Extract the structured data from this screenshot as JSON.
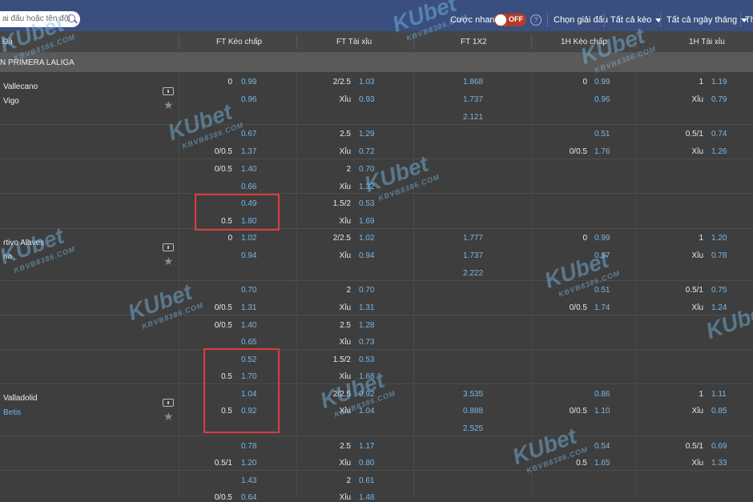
{
  "topbar": {
    "search_placeholder": "ai đấu hoặc tên đội",
    "quick_bet_label": "Cược nhanh",
    "toggle_state": "OFF",
    "help_icon": "?",
    "league_select": "Chọn giải đấu",
    "all_markets": "Tất cả kèo",
    "all_dates": "Tất cả ngày tháng",
    "cut_item": "Th"
  },
  "columns": {
    "match": "Đá",
    "ft_handicap": "FT Kèo chấp",
    "ft_ou": "FT Tài xỉu",
    "ft_1x2": "FT 1X2",
    "h1_handicap": "1H Kèo chấp",
    "h1_ou": "1H Tài xỉu"
  },
  "league": "N PRIMERA LALIGA",
  "matches": [
    {
      "home": "Vallecano",
      "away": "Vigo",
      "home_blue": false,
      "away_blue": false
    },
    {
      "home": "rtivo Alaves",
      "away": "na",
      "home_blue": false,
      "away_blue": false
    },
    {
      "home": "Valladolid",
      "away": "Betis",
      "home_blue": false,
      "away_blue": true
    }
  ],
  "icons": {
    "stats": "stats-icon",
    "star": "★"
  },
  "rows": [
    {
      "hh": "0",
      "ho": "0.99",
      "th": "2/2.5",
      "to": "1.03",
      "x": "1.868",
      "h1h": "0",
      "h1o": "0.99",
      "t1h": "1",
      "t1o": "1.19"
    },
    {
      "hh": "",
      "ho": "0.96",
      "th": "Xỉu",
      "to": "0.93",
      "x": "1.737",
      "h1h": "",
      "h1o": "0.96",
      "t1h": "Xỉu",
      "t1o": "0.79"
    },
    {
      "hh": "",
      "ho": "",
      "th": "",
      "to": "",
      "x": "2.121",
      "h1h": "",
      "h1o": "",
      "t1h": "",
      "t1o": ""
    },
    {
      "hh": "",
      "ho": "0.67",
      "th": "2.5",
      "to": "1.29",
      "x": "",
      "h1h": "",
      "h1o": "0.51",
      "t1h": "0.5/1",
      "t1o": "0.74"
    },
    {
      "hh": "0/0.5",
      "ho": "1.37",
      "th": "Xỉu",
      "to": "0.72",
      "x": "",
      "h1h": "0/0.5",
      "h1o": "1.76",
      "t1h": "Xỉu",
      "t1o": "1.26"
    },
    {
      "hh": "0/0.5",
      "ho": "1.40",
      "th": "2",
      "to": "0.70",
      "x": "",
      "h1h": "",
      "h1o": "",
      "t1h": "",
      "t1o": ""
    },
    {
      "hh": "",
      "ho": "0.66",
      "th": "Xỉu",
      "to": "1.32",
      "x": "",
      "h1h": "",
      "h1o": "",
      "t1h": "",
      "t1o": ""
    },
    {
      "hh": "",
      "ho": "0.49",
      "th": "1.5/2",
      "to": "0.53",
      "x": "",
      "h1h": "",
      "h1o": "",
      "t1h": "",
      "t1o": ""
    },
    {
      "hh": "0.5",
      "ho": "1.80",
      "th": "Xỉu",
      "to": "1.69",
      "x": "",
      "h1h": "",
      "h1o": "",
      "t1h": "",
      "t1o": ""
    },
    {
      "hh": "0",
      "ho": "1.02",
      "th": "2/2.5",
      "to": "1.02",
      "x": "1.777",
      "h1h": "0",
      "h1o": "0.99",
      "t1h": "1",
      "t1o": "1.20"
    },
    {
      "hh": "",
      "ho": "0.94",
      "th": "Xỉu",
      "to": "0.94",
      "x": "1.737",
      "h1h": "",
      "h1o": "0.97",
      "t1h": "Xỉu",
      "t1o": "0.78"
    },
    {
      "hh": "",
      "ho": "",
      "th": "",
      "to": "",
      "x": "2.222",
      "h1h": "",
      "h1o": "",
      "t1h": "",
      "t1o": ""
    },
    {
      "hh": "",
      "ho": "0.70",
      "th": "2",
      "to": "0.70",
      "x": "",
      "h1h": "",
      "h1o": "0.51",
      "t1h": "0.5/1",
      "t1o": "0.75"
    },
    {
      "hh": "0/0.5",
      "ho": "1.31",
      "th": "Xỉu",
      "to": "1.31",
      "x": "",
      "h1h": "0/0.5",
      "h1o": "1.74",
      "t1h": "Xỉu",
      "t1o": "1.24"
    },
    {
      "hh": "0/0.5",
      "ho": "1.40",
      "th": "2.5",
      "to": "1.28",
      "x": "",
      "h1h": "",
      "h1o": "",
      "t1h": "",
      "t1o": ""
    },
    {
      "hh": "",
      "ho": "0.65",
      "th": "Xỉu",
      "to": "0.73",
      "x": "",
      "h1h": "",
      "h1o": "",
      "t1h": "",
      "t1o": ""
    },
    {
      "hh": "",
      "ho": "0.52",
      "th": "1.5/2",
      "to": "0.53",
      "x": "",
      "h1h": "",
      "h1o": "",
      "t1h": "",
      "t1o": ""
    },
    {
      "hh": "0.5",
      "ho": "1.70",
      "th": "Xỉu",
      "to": "1.68",
      "x": "",
      "h1h": "",
      "h1o": "",
      "t1h": "",
      "t1o": ""
    },
    {
      "hh": "",
      "ho": "1.04",
      "th": "2/2.5",
      "to": "0.92",
      "x": "3.535",
      "h1h": "",
      "h1o": "0.86",
      "t1h": "1",
      "t1o": "1.11"
    },
    {
      "hh": "0.5",
      "ho": "0.92",
      "th": "Xỉu",
      "to": "1.04",
      "x": "0.888",
      "h1h": "0/0.5",
      "h1o": "1.10",
      "t1h": "Xỉu",
      "t1o": "0.85"
    },
    {
      "hh": "",
      "ho": "",
      "th": "",
      "to": "",
      "x": "2.525",
      "h1h": "",
      "h1o": "",
      "t1h": "",
      "t1o": ""
    },
    {
      "hh": "",
      "ho": "0.78",
      "th": "2.5",
      "to": "1.17",
      "x": "",
      "h1h": "",
      "h1o": "0.54",
      "t1h": "0.5/1",
      "t1o": "0.69"
    },
    {
      "hh": "0.5/1",
      "ho": "1.20",
      "th": "Xỉu",
      "to": "0.80",
      "x": "",
      "h1h": "0.5",
      "h1o": "1.65",
      "t1h": "Xỉu",
      "t1o": "1.33"
    },
    {
      "hh": "",
      "ho": "1.43",
      "th": "2",
      "to": "0.61",
      "x": "",
      "h1h": "",
      "h1o": "",
      "t1h": "",
      "t1o": ""
    },
    {
      "hh": "0/0.5",
      "ho": "0.64",
      "th": "Xỉu",
      "to": "1.48",
      "x": "",
      "h1h": "",
      "h1o": "",
      "t1h": "",
      "t1o": ""
    }
  ],
  "watermark": {
    "brand": "KUbet",
    "domain": "KBVB8386.COM"
  },
  "colors": {
    "header": "#3a4f7e",
    "odds": "#78b6e6",
    "highlight": "#e03a3a",
    "toggle": "#b63a2c"
  }
}
